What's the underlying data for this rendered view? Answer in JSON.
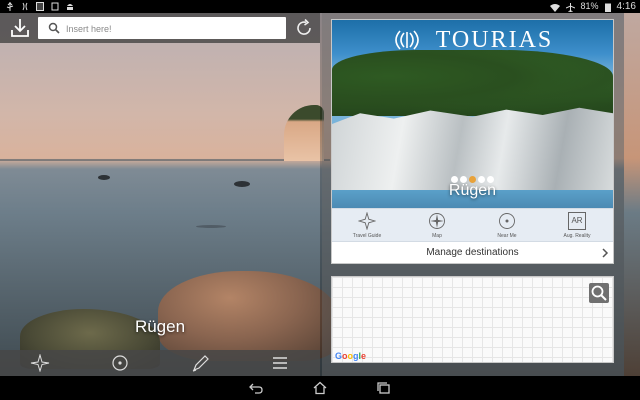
{
  "status_bar": {
    "left_icons": [
      "usb-icon",
      "notification-icon",
      "flash-icon",
      "square-icon",
      "android-icon"
    ],
    "battery_text": "81%",
    "time": "4:16"
  },
  "search": {
    "placeholder": "Insert here!"
  },
  "place": {
    "name": "Rügen"
  },
  "left_toolbar": {
    "items": [
      "travel-guide-icon",
      "near-me-icon",
      "edit-pen-icon",
      "menu-icon"
    ]
  },
  "card": {
    "brand": "TOURIAS",
    "place": "Rügen",
    "pager": {
      "count": 5,
      "active_index": 2
    },
    "nav": [
      {
        "icon": "star-outline-icon",
        "label": "Travel Guide"
      },
      {
        "icon": "compass-icon",
        "label": "Map"
      },
      {
        "icon": "near-me-icon",
        "label": "Near Me"
      },
      {
        "icon": "ar-icon",
        "label": "Aug. Reality",
        "glyph": "AR"
      }
    ],
    "manage_label": "Manage destinations"
  },
  "map": {
    "attribution": "Google",
    "colors": [
      "#4285F4",
      "#EA4335",
      "#FBBC05",
      "#4285F4",
      "#34A853",
      "#EA4335"
    ]
  },
  "android_nav": [
    "back-icon",
    "home-icon",
    "recents-icon"
  ]
}
